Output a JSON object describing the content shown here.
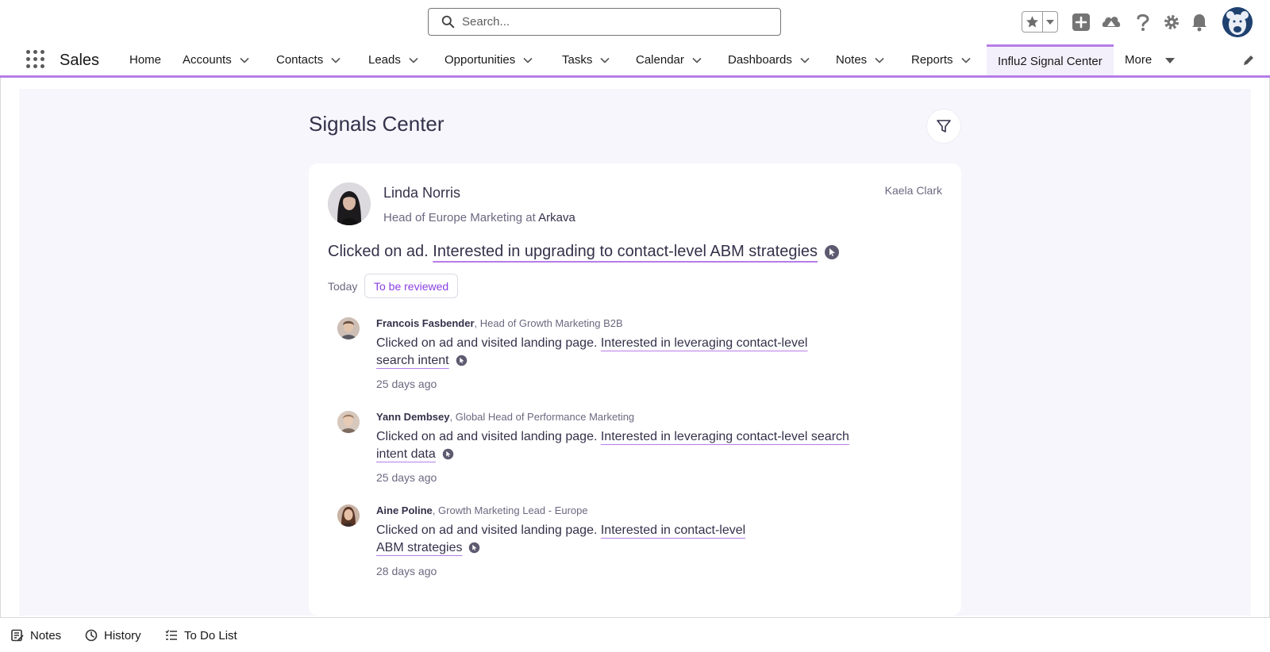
{
  "header": {
    "search_placeholder": "Search...",
    "icons": [
      "favorites-star-icon",
      "favorites-dropdown-icon",
      "global-create-icon",
      "trailhead-icon",
      "help-icon",
      "setup-gear-icon",
      "notifications-bell-icon",
      "user-avatar"
    ]
  },
  "nav": {
    "app_name": "Sales",
    "items": [
      {
        "label": "Home",
        "has_menu": false
      },
      {
        "label": "Accounts",
        "has_menu": true
      },
      {
        "label": "Contacts",
        "has_menu": true
      },
      {
        "label": "Leads",
        "has_menu": true
      },
      {
        "label": "Opportunities",
        "has_menu": true
      },
      {
        "label": "Tasks",
        "has_menu": true
      },
      {
        "label": "Calendar",
        "has_menu": true
      },
      {
        "label": "Dashboards",
        "has_menu": true
      },
      {
        "label": "Notes",
        "has_menu": true
      },
      {
        "label": "Reports",
        "has_menu": true
      },
      {
        "label": "Influ2 Signal Center",
        "has_menu": false,
        "active": true
      },
      {
        "label": "More",
        "has_menu": true
      }
    ]
  },
  "page": {
    "title": "Signals Center"
  },
  "card": {
    "lead_name": "Linda Norris",
    "lead_title_prefix": "Head of Europe Marketing at ",
    "lead_company": "Arkava",
    "owner": "Kaela Clark",
    "signal_prefix": "Clicked on ad. ",
    "signal_link": "Interested in upgrading to contact-level ABM strategies",
    "date_label": "Today",
    "status": "To be reviewed",
    "activities": [
      {
        "name": "Francois Fasbender",
        "title": ", Head of Growth Marketing B2B",
        "action": "Clicked on ad and visited landing page. ",
        "link_line1": "Interested in leveraging contact-level",
        "link_line2": "search intent",
        "time": "25 days ago"
      },
      {
        "name": "Yann Dembsey",
        "title": ", Global Head of Performance Marketing",
        "action": "Clicked on ad and visited landing page. ",
        "link_line1": "Interested in leveraging contact-level search",
        "link_line2": "intent data",
        "time": "25 days ago"
      },
      {
        "name": "Aine Poline",
        "title": ", Growth Marketing Lead - Europe",
        "action": "Clicked on ad and visited landing page. ",
        "link_line1": "Interested in contact-level",
        "link_line2": "ABM strategies",
        "time": "28 days ago"
      }
    ]
  },
  "utility_bar": {
    "items": [
      {
        "label": "Notes",
        "icon": "notes-icon"
      },
      {
        "label": "History",
        "icon": "history-clock-icon"
      },
      {
        "label": "To Do List",
        "icon": "todo-list-icon"
      }
    ]
  },
  "colors": {
    "accent": "#b67de8",
    "status_text": "#8a3fe0",
    "workspace_bg": "#f6f6fc",
    "text_dark": "#34314a",
    "text_muted": "#6b6980"
  }
}
